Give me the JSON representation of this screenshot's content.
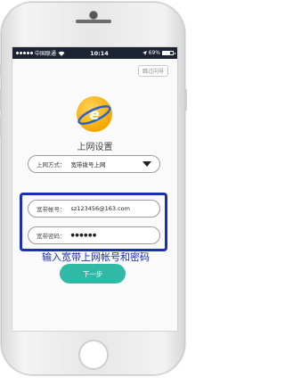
{
  "status_bar": {
    "carrier": "中国联通",
    "time": "10:14",
    "battery": "69%",
    "battery_level": 0.69
  },
  "skip_button": "跳过向导",
  "page_title": "上网设置",
  "connection_type": {
    "label": "上网方式：",
    "value": "宽带拨号上网"
  },
  "account": {
    "label": "宽带帐号：",
    "value": "sz123456@163.com"
  },
  "password": {
    "label": "宽带密码：",
    "value": "●●●●●●"
  },
  "annotation": "输入宽带上网帐号和密码",
  "next_button": "下一步",
  "colors": {
    "accent": "#2fb9a6",
    "highlight": "#1b2fb3",
    "status_bar": "#1c2433",
    "logo": "#f5a800"
  }
}
